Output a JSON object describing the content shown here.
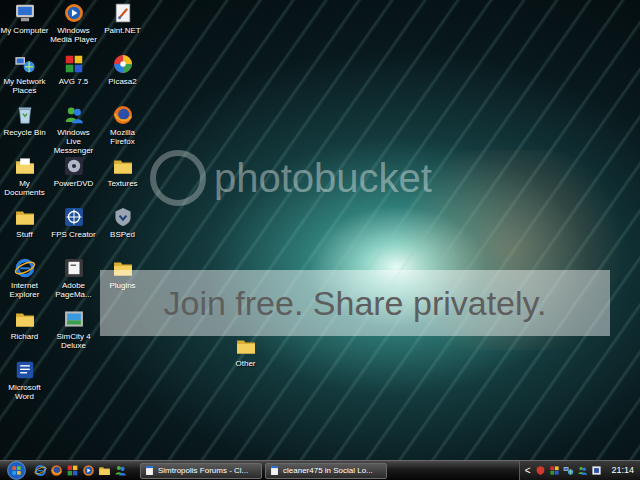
{
  "desktop": {
    "columns": [
      [
        {
          "label": "My Computer",
          "kind": "computer"
        },
        {
          "label": "My Network Places",
          "kind": "network"
        },
        {
          "label": "Recycle Bin",
          "kind": "recycle"
        },
        {
          "label": "My Documents",
          "kind": "documents"
        },
        {
          "label": "Stuff",
          "kind": "folder"
        },
        {
          "label": "Internet Explorer",
          "kind": "ie"
        },
        {
          "label": "Richard",
          "kind": "folder"
        },
        {
          "label": "Microsoft Word",
          "kind": "word"
        }
      ],
      [
        {
          "label": "Windows Media Player",
          "kind": "mediaplayer"
        },
        {
          "label": "AVG 7.5",
          "kind": "avg"
        },
        {
          "label": "Windows Live Messenger",
          "kind": "messenger"
        },
        {
          "label": "PowerDVD",
          "kind": "dvd"
        },
        {
          "label": "FPS Creator",
          "kind": "fps"
        },
        {
          "label": "Adobe PageMa...",
          "kind": "pagemaker"
        },
        {
          "label": "SimCity 4 Deluxe",
          "kind": "simcity"
        }
      ],
      [
        {
          "label": "Paint.NET",
          "kind": "paintnet"
        },
        {
          "label": "Picasa2",
          "kind": "picasa"
        },
        {
          "label": "Mozilla Firefox",
          "kind": "firefox"
        },
        {
          "label": "Textures",
          "kind": "folder"
        },
        {
          "label": "BSPed",
          "kind": "bsp"
        },
        {
          "label": "Plugins",
          "kind": "folder"
        }
      ]
    ],
    "loose": [
      {
        "label": "Other",
        "kind": "folder"
      }
    ]
  },
  "watermark": {
    "logo": "photobucket",
    "banner": "Join free. Share privately."
  },
  "taskbar": {
    "quick_launch": [
      {
        "kind": "ie"
      },
      {
        "kind": "firefox"
      },
      {
        "kind": "avg"
      },
      {
        "kind": "mediaplayer"
      },
      {
        "kind": "folder"
      },
      {
        "kind": "messenger"
      }
    ],
    "tasks": [
      {
        "label": "Simtropolis Forums - Cl...",
        "selected": false
      },
      {
        "label": "cleaner475 in Social Lo...",
        "selected": false
      }
    ],
    "tray": {
      "expand": "<",
      "icons": [
        {
          "kind": "shield"
        },
        {
          "kind": "avg"
        },
        {
          "kind": "network"
        },
        {
          "kind": "messenger"
        },
        {
          "kind": "lang"
        }
      ],
      "clock": "21:14"
    }
  }
}
